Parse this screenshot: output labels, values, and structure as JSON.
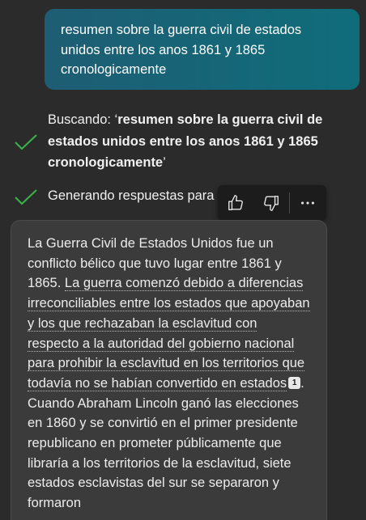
{
  "user_message": {
    "text": "resumen sobre la guerra civil de estados unidos entre los anos 1861 y 1865 cronologicamente"
  },
  "status": {
    "searching_prefix": "Buscando: ‘",
    "searching_query": "resumen sobre la guerra civil de estados unidos entre los anos 1861 y 1865 cronologicamente",
    "searching_suffix": "’",
    "generating": "Generando respuestas para"
  },
  "actions": {
    "like_icon": "thumbs-up-icon",
    "dislike_icon": "thumbs-down-icon",
    "more_icon": "more-options-icon"
  },
  "answer": {
    "part1": "La Guerra Civil de Estados Unidos fue un conflicto bélico que tuvo lugar entre 1861 y 1865.",
    "cited1": "La guerra comenzó debido a diferencias irreconciliables entre los estados que apoyaban y los que rechazaban la esclavitud con respecto a la autoridad del gobierno nacional para prohibir la esclavitud en los territorios que todavía no se habían convertido en estados",
    "cite1_number": "1",
    "part2": ". Cuando Abraham Lincoln ganó las elecciones en 1860 y se convirtió en el primer presidente republicano en prometer públicamente que libraría a los territorios de la esclavitud, siete estados esclavistas del sur se separaron y formaron"
  },
  "colors": {
    "background": "#2b2b2b",
    "user_bubble_start": "#1e5d73",
    "user_bubble_end": "#0f6d7a",
    "check_green": "#3ab44a",
    "card_background": "#3b3b3b"
  }
}
